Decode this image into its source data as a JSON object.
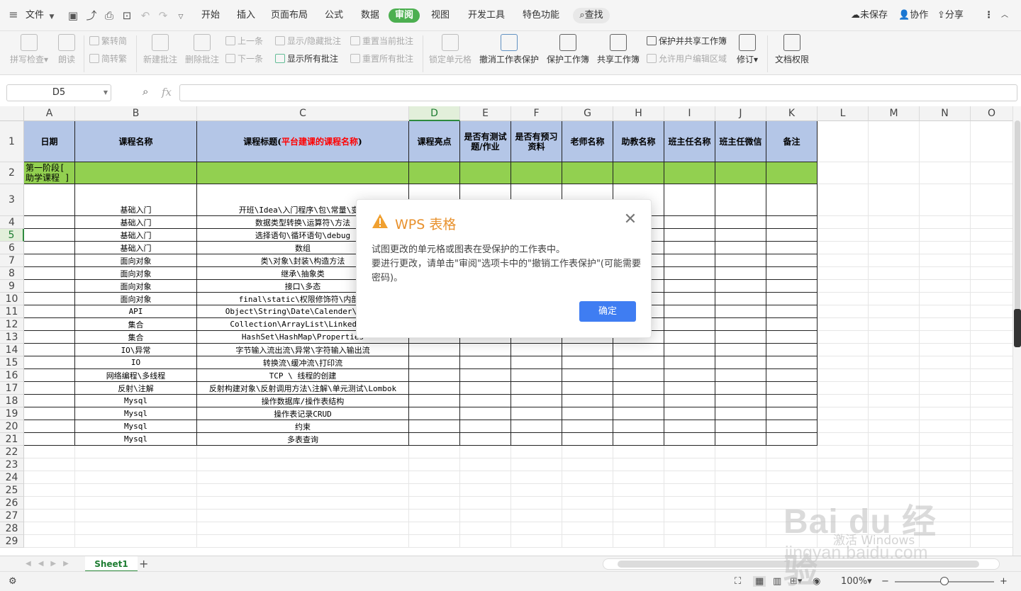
{
  "menu": {
    "file": "文件",
    "tabs": [
      "开始",
      "插入",
      "页面布局",
      "公式",
      "数据",
      "审阅",
      "视图",
      "开发工具",
      "特色功能"
    ],
    "active_tab": "审阅",
    "search": "查找",
    "unsaved": "未保存",
    "collab": "协作",
    "share": "分享"
  },
  "ribbon": {
    "spellcheck": "拼写检查",
    "read_aloud": "朗读",
    "trad_to_simp": "繁转简",
    "simp_to_trad": "简转繁",
    "new_comment": "新建批注",
    "delete_comment": "删除批注",
    "prev": "上一条",
    "next": "下一条",
    "show_hide_comment": "显示/隐藏批注",
    "show_all_comments": "显示所有批注",
    "reset_current_comment": "重置当前批注",
    "reset_all_comments": "重置所有批注",
    "lock_cell": "锁定单元格",
    "unprotect_sheet": "撤消工作表保护",
    "protect_workbook": "保护工作簿",
    "share_workbook": "共享工作簿",
    "protect_and_share": "保护并共享工作簿",
    "allow_edit_ranges": "允许用户编辑区域",
    "track_changes": "修订",
    "doc_rights": "文档权限"
  },
  "formula_bar": {
    "name_box": "D5",
    "fx": "fx",
    "formula": ""
  },
  "columns": [
    "A",
    "B",
    "C",
    "D",
    "E",
    "F",
    "G",
    "H",
    "I",
    "J",
    "K",
    "L",
    "M",
    "N",
    "O"
  ],
  "selected_column": "D",
  "selected_row": "5",
  "rows": [
    "1",
    "2",
    "3",
    "4",
    "5",
    "6",
    "7",
    "8",
    "9",
    "10",
    "11",
    "12",
    "13",
    "14",
    "15",
    "16",
    "17",
    "18",
    "19",
    "20",
    "21",
    "22",
    "23",
    "24",
    "25",
    "26",
    "27",
    "28",
    "29"
  ],
  "header_row": {
    "A": "日期",
    "B": "课程名称",
    "C_prefix": "课程标题(",
    "C_red": "平台建课的课程名称",
    "C_suffix": ")",
    "D": "课程亮点",
    "E": "是否有测试题/作业",
    "F": "是否有预习资料",
    "G": "老师名称",
    "H": "助教名称",
    "I": "班主任名称",
    "J": "班主任微信",
    "K": "备注",
    "red_color": "#ff0000"
  },
  "stage_row": {
    "A": "第一阶段[ 助学课程 ]",
    "fill": "#92d050"
  },
  "header_fill": "#b4c6e7",
  "data_rows": [
    {
      "B": "基础入门",
      "C": "开班\\Idea\\入门程序\\包\\常量\\变量"
    },
    {
      "B": "基础入门",
      "C": "数据类型转换\\运算符\\方法"
    },
    {
      "B": "基础入门",
      "C": "选择语句\\循环语句\\debug"
    },
    {
      "B": "基础入门",
      "C": "数组"
    },
    {
      "B": "面向对象",
      "C": "类\\对象\\封装\\构造方法"
    },
    {
      "B": "面向对象",
      "C": "继承\\抽象类"
    },
    {
      "B": "面向对象",
      "C": "接口\\多态"
    },
    {
      "B": "面向对象",
      "C": "final\\static\\权限修饰符\\内部类"
    },
    {
      "B": "API",
      "C": "Object\\String\\Date\\Calender\\Array"
    },
    {
      "B": "集合",
      "C": "Collection\\ArrayList\\LinkedList"
    },
    {
      "B": "集合",
      "C": "HashSet\\HashMap\\Properties"
    },
    {
      "B": "IO\\异常",
      "C": "字节输入流出流\\异常\\字符输入输出流"
    },
    {
      "B": "IO",
      "C": "转换流\\缓冲流\\打印流"
    },
    {
      "B": "网络编程\\多线程",
      "C": "TCP \\ 线程的创建"
    },
    {
      "B": "反射\\注解",
      "C": "反射构建对象\\反射调用方法\\注解\\单元测试\\Lombok"
    },
    {
      "B": "Mysql",
      "C": "操作数据库/操作表结构"
    },
    {
      "B": "Mysql",
      "C": "操作表记录CRUD"
    },
    {
      "B": "Mysql",
      "C": "约束"
    },
    {
      "B": "Mysql",
      "C": "多表查询"
    }
  ],
  "dialog": {
    "title": "WPS 表格",
    "line1": "试图更改的单元格或图表在受保护的工作表中。",
    "line2": "要进行更改，请单击\"审阅\"选项卡中的\"撤销工作表保护\"(可能需要密码)。",
    "ok": "确定",
    "title_color": "#e8912d",
    "ok_color": "#3f7df2"
  },
  "sheet_tabs": {
    "tab1": "Sheet1",
    "add": "+"
  },
  "status": {
    "zoom": "100%",
    "zoom_level": 1.0
  },
  "watermark": {
    "logo": "Bai du 经验",
    "site": "jingyan.baidu.com",
    "windows": "激活 Windows"
  }
}
